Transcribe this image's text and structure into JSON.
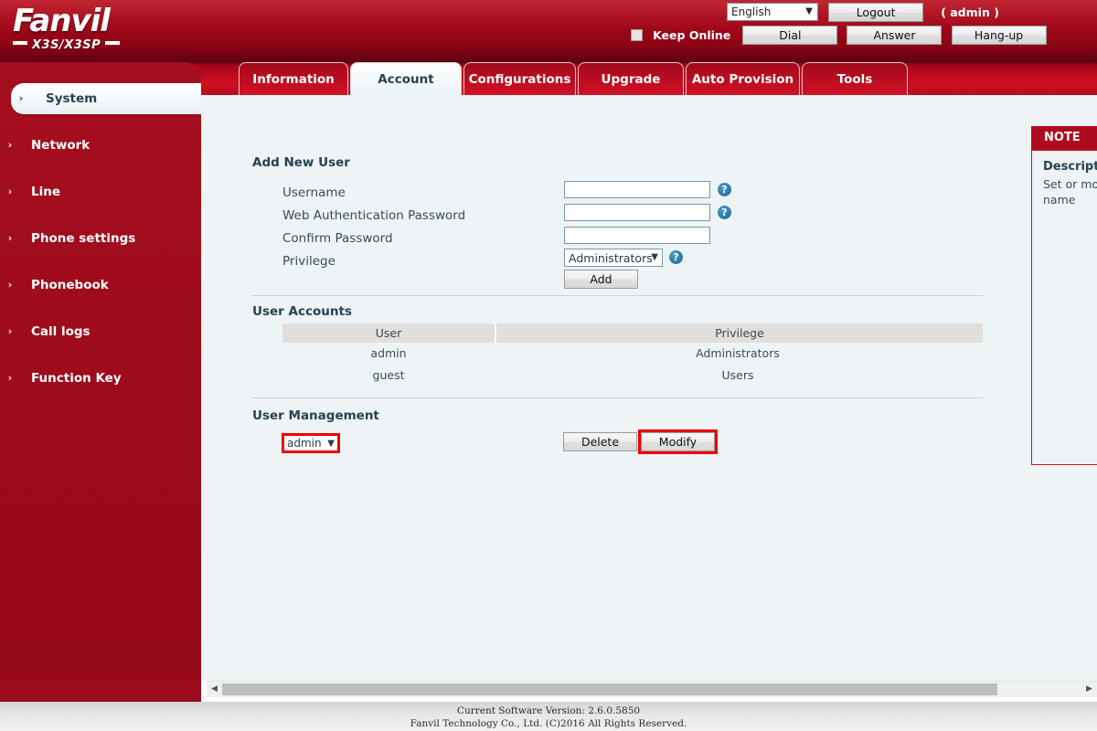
{
  "brand": {
    "logo_text": "Fanvil",
    "model": "X3S/X3SP"
  },
  "header": {
    "language_selected": "English",
    "logout_label": "Logout",
    "admin_label": "( admin )",
    "keep_online_label": "Keep Online",
    "dial_label": "Dial",
    "answer_label": "Answer",
    "hangup_label": "Hang-up"
  },
  "tabs": [
    {
      "label": "Information",
      "active": false,
      "width": 120
    },
    {
      "label": "Account",
      "active": true,
      "width": 122
    },
    {
      "label": "Configurations",
      "active": false,
      "width": 123
    },
    {
      "label": "Upgrade",
      "active": false,
      "width": 116
    },
    {
      "label": "Auto Provision",
      "active": false,
      "width": 125
    },
    {
      "label": "Tools",
      "active": false,
      "width": 116
    }
  ],
  "sidebar": {
    "items": [
      {
        "label": "System",
        "active": true
      },
      {
        "label": "Network",
        "active": false
      },
      {
        "label": "Line",
        "active": false
      },
      {
        "label": "Phone settings",
        "active": false
      },
      {
        "label": "Phonebook",
        "active": false
      },
      {
        "label": "Call logs",
        "active": false
      },
      {
        "label": "Function Key",
        "active": false
      }
    ],
    "chevron": "›"
  },
  "main": {
    "add_new_user": {
      "title": "Add New User",
      "fields": [
        {
          "label": "Username",
          "value": "",
          "has_help": true
        },
        {
          "label": "Web Authentication Password",
          "value": "",
          "has_help": true
        },
        {
          "label": "Confirm Password",
          "value": "",
          "has_help": false
        }
      ],
      "privilege_label": "Privilege",
      "privilege_value": "Administrators",
      "add_button": "Add"
    },
    "user_accounts": {
      "title": "User Accounts",
      "columns": [
        "User",
        "Privilege"
      ],
      "rows": [
        [
          "admin",
          "Administrators"
        ],
        [
          "guest",
          "Users"
        ]
      ]
    },
    "user_management": {
      "title": "User Management",
      "selected_user": "admin",
      "delete_button": "Delete",
      "modify_button": "Modify"
    }
  },
  "note": {
    "header": "NOTE",
    "description_title": "Description:",
    "description_text": "Set or modify the user name"
  },
  "footer": {
    "version_line": "Current Software Version: 2.6.0.5850",
    "copyright_line": "Fanvil Technology Co., Ltd. (C)2016 All Rights Reserved."
  },
  "icons": {
    "help": "?",
    "caret_down": "▼",
    "arrow_left": "◀",
    "arrow_right": "▶"
  },
  "colors": {
    "brand_red": "#a50f1f",
    "tab_red": "#cf0f22",
    "content_bg": "#eef4f6",
    "highlight_red": "#ee0000",
    "help_blue": "#2d7ba8"
  }
}
